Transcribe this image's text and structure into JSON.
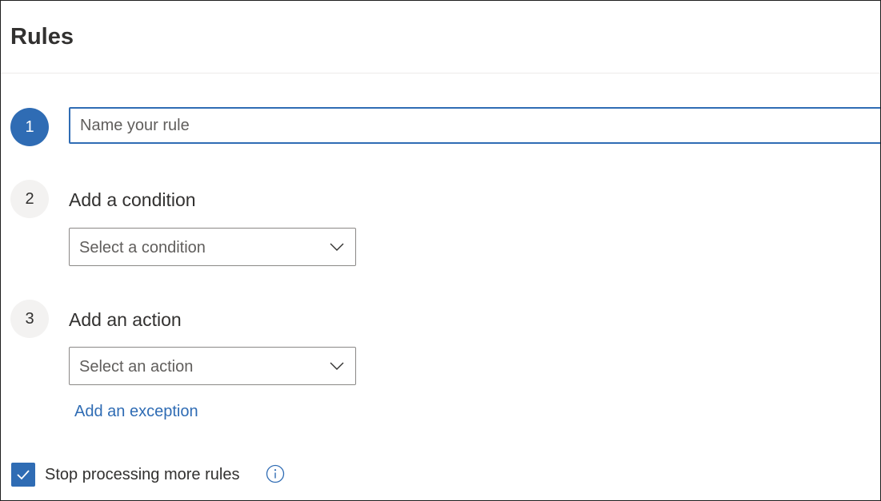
{
  "header": {
    "title": "Rules"
  },
  "steps": [
    {
      "number": "1",
      "input_value": "",
      "input_placeholder": "Name your rule"
    },
    {
      "number": "2",
      "label": "Add a condition",
      "dropdown_value": "Select a condition",
      "icon": "chevron-down-icon"
    },
    {
      "number": "3",
      "label": "Add an action",
      "dropdown_value": "Select an action",
      "icon": "chevron-down-icon"
    }
  ],
  "exception_link": "Add an exception",
  "stop_processing": {
    "label": "Stop processing more rules",
    "checked": true,
    "icon": "info-icon"
  },
  "colors": {
    "accent": "#2f6cb4",
    "text": "#323130",
    "placeholder": "#605e5c",
    "step_circle_bg": "#f3f2f1"
  }
}
